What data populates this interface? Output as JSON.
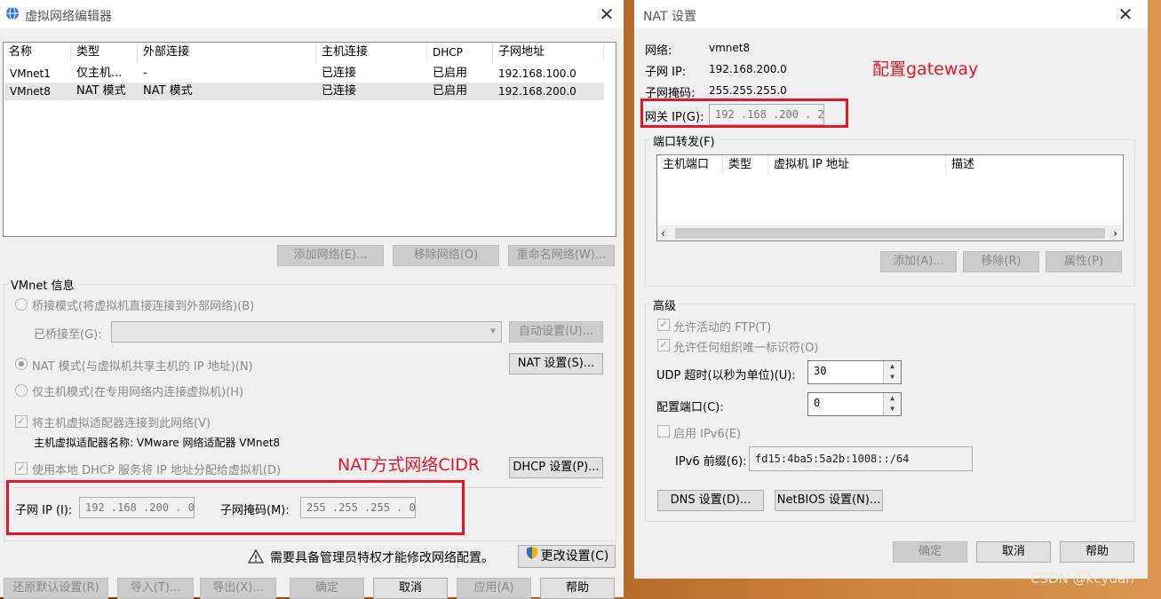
{
  "left": {
    "title": "虚拟网络编辑器",
    "close": "✕",
    "table": {
      "headers": [
        "名称",
        "类型",
        "外部连接",
        "主机连接",
        "DHCP",
        "子网地址"
      ],
      "rows": [
        [
          "VMnet1",
          "仅主机...",
          "-",
          "已连接",
          "已启用",
          "192.168.100.0"
        ],
        [
          "VMnet8",
          "NAT 模式",
          "NAT 模式",
          "已连接",
          "已启用",
          "192.168.200.0"
        ]
      ]
    },
    "buttons": {
      "add": "添加网络(E)...",
      "remove": "移除网络(O)",
      "rename": "重命名网络(W)..."
    },
    "vmnet_info": {
      "label": "VMnet 信息",
      "bridge_mode": "桥接模式(将虚拟机直接连接到外部网络)(B)",
      "bridged_to": "已桥接至(G):",
      "auto_settings": "自动设置(U)...",
      "nat_mode": "NAT 模式(与虚拟机共享主机的 IP 地址)(N)",
      "nat_settings": "NAT 设置(S)...",
      "host_only": "仅主机模式(在专用网络内连接虚拟机)(H)",
      "connect_adapter": "将主机虚拟适配器连接到此网络(V)",
      "adapter_name": "主机虚拟适配器名称: VMware 网络适配器 VMnet8",
      "use_dhcp": "使用本地 DHCP 服务将 IP 地址分配给虚拟机(D)",
      "dhcp_settings": "DHCP 设置(P)...",
      "subnet_ip_label": "子网 IP (I):",
      "subnet_ip": "192 .168 .200 .  0",
      "subnet_mask_label": "子网掩码(M):",
      "subnet_mask": "255 .255 .255 .  0"
    },
    "warning_text": "需要具备管理员特权才能修改网络配置。",
    "change_settings": "更改设置(C)",
    "bottom_buttons": [
      "还原默认设置(R)",
      "导入(T)...",
      "导出(X)...",
      "确定",
      "取消",
      "应用(A)",
      "帮助"
    ]
  },
  "right": {
    "title": "NAT 设置",
    "close": "✕",
    "network_label": "网络:",
    "network_value": "vmnet8",
    "subnet_ip_label": "子网 IP:",
    "subnet_ip_value": "192.168.200.0",
    "subnet_mask_label": "子网掩码:",
    "subnet_mask_value": "255.255.255.0",
    "gateway_label": "网关 IP(G):",
    "gateway_value": "192 .168 .200 .  2",
    "port_forward_label": "端口转发(F)",
    "pf_headers": [
      "主机端口",
      "类型",
      "虚拟机 IP 地址",
      "描述"
    ],
    "pf_buttons": [
      "添加(A)...",
      "移除(R)",
      "属性(P)"
    ],
    "advanced_label": "高级",
    "allow_ftp": "允许活动的 FTP(T)",
    "allow_oui": "允许任何组织唯一标识符(O)",
    "udp_timeout_label": "UDP 超时(以秒为单位)(U):",
    "udp_timeout_value": "30",
    "config_port_label": "配置端口(C):",
    "config_port_value": "0",
    "enable_ipv6": "启用 IPv6(E)",
    "ipv6_prefix_label": "IPv6 前缀(6):",
    "ipv6_prefix_value": "fd15:4ba5:5a2b:1008::/64",
    "dns_settings": "DNS 设置(D)...",
    "netbios_settings": "NetBIOS 设置(N)...",
    "bottom_buttons": [
      "确定",
      "取消",
      "帮助"
    ]
  },
  "annotations": {
    "gateway": "配置gateway",
    "cidr": "NAT方式网络CIDR"
  },
  "watermark": "CSDN @kcyuan",
  "colors": {
    "annotation_red": "#e2182a",
    "window_bg": "#f0f0f0"
  }
}
